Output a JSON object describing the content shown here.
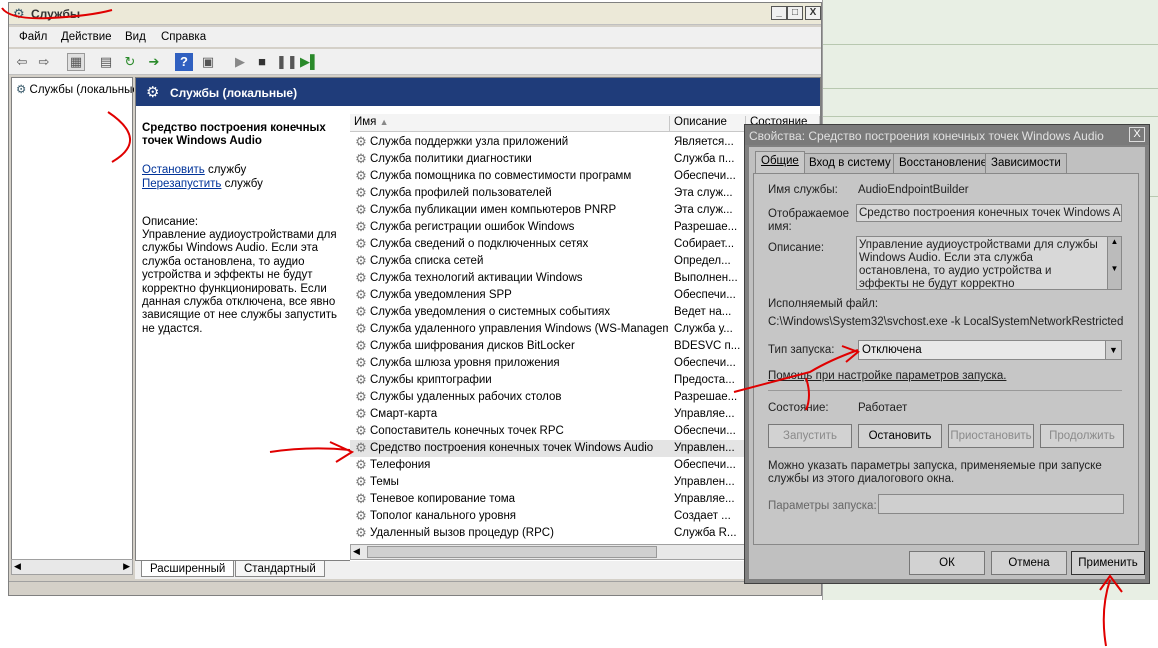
{
  "window": {
    "title": "Службы",
    "controls": [
      "_",
      "□",
      "X"
    ]
  },
  "menu": [
    "Файл",
    "Действие",
    "Вид",
    "Справка"
  ],
  "toolbar_icons": [
    "back-icon",
    "forward-icon",
    "console-tree-icon",
    "properties-icon",
    "refresh-icon",
    "export-icon",
    "help-icon",
    "view-icon",
    "play-icon",
    "stop-icon",
    "pause-icon",
    "restart-icon"
  ],
  "tree": {
    "item": "Службы (локальные)"
  },
  "content": {
    "header": "Службы (локальные)",
    "service_title": "Средство построения конечных точек Windows Audio",
    "stop_link": "Остановить",
    "stop_suffix": " службу",
    "restart_link": "Перезапустить",
    "restart_suffix": " службу",
    "desc_label": "Описание:",
    "desc_text": "Управление аудиоустройствами для службы Windows Audio.  Если эта служба остановлена, то аудио устройства и эффекты не будут корректно функционировать.  Если данная служба отключена, все явно зависящие от нее службы запустить не удастся."
  },
  "list": {
    "columns": [
      "Имя",
      "Описание",
      "Состояние"
    ],
    "rows": [
      {
        "name": "Служба поддержки узла приложений",
        "desc": "Является..."
      },
      {
        "name": "Служба политики диагностики",
        "desc": "Служба п..."
      },
      {
        "name": "Служба помощника по совместимости программ",
        "desc": "Обеспечи..."
      },
      {
        "name": "Служба профилей пользователей",
        "desc": "Эта служ..."
      },
      {
        "name": "Служба публикации имен компьютеров PNRP",
        "desc": "Эта служ..."
      },
      {
        "name": "Служба регистрации ошибок Windows",
        "desc": "Разрешае..."
      },
      {
        "name": "Служба сведений о подключенных сетях",
        "desc": "Собирает..."
      },
      {
        "name": "Служба списка сетей",
        "desc": "Определ..."
      },
      {
        "name": "Служба технологий активации Windows",
        "desc": "Выполнен..."
      },
      {
        "name": "Служба уведомления SPP",
        "desc": "Обеспечи..."
      },
      {
        "name": "Служба уведомления о системных событиях",
        "desc": "Ведет на..."
      },
      {
        "name": "Служба удаленного управления Windows (WS-Managem...",
        "desc": "Служба у..."
      },
      {
        "name": "Служба шифрования дисков BitLocker",
        "desc": "BDESVC п..."
      },
      {
        "name": "Служба шлюза уровня приложения",
        "desc": "Обеспечи..."
      },
      {
        "name": "Службы криптографии",
        "desc": "Предоста..."
      },
      {
        "name": "Службы удаленных рабочих столов",
        "desc": "Разрешае..."
      },
      {
        "name": "Смарт-карта",
        "desc": "Управляе..."
      },
      {
        "name": "Сопоставитель конечных точек RPC",
        "desc": "Обеспечи..."
      },
      {
        "name": "Средство построения конечных точек Windows Audio",
        "desc": "Управлен..."
      },
      {
        "name": "Телефония",
        "desc": "Обеспечи..."
      },
      {
        "name": "Темы",
        "desc": "Управлен..."
      },
      {
        "name": "Теневое копирование тома",
        "desc": "Управляе..."
      },
      {
        "name": "Тополог канального уровня",
        "desc": "Создает ..."
      },
      {
        "name": "Удаленный вызов процедур (RPC)",
        "desc": "Служба R..."
      }
    ],
    "selected_index": 18
  },
  "bottom_tabs": [
    "Расширенный",
    "Стандартный"
  ],
  "dialog": {
    "title": "Свойства: Средство построения конечных точек Windows Audio",
    "close": "X",
    "tabs": [
      "Общие",
      "Вход в систему",
      "Восстановление",
      "Зависимости"
    ],
    "service_name_label": "Имя службы:",
    "service_name": "AudioEndpointBuilder",
    "display_name_label": "Отображаемое имя:",
    "display_name": "Средство построения конечных точек Windows Audio",
    "description_label": "Описание:",
    "description": "Управление аудиоустройствами для службы Windows Audio.  Если эта служба остановлена, то аудио устройства и эффекты не будут корректно функционировать.  Если данная",
    "exe_label": "Исполняемый файл:",
    "exe_path": "C:\\Windows\\System32\\svchost.exe -k LocalSystemNetworkRestricted",
    "startup_type_label": "Тип запуска:",
    "startup_type": "Отключена",
    "help_link": "Помощь при настройке параметров запуска.",
    "state_label": "Состояние:",
    "state": "Работает",
    "btn_start": "Запустить",
    "btn_stop": "Остановить",
    "btn_pause": "Приостановить",
    "btn_continue": "Продолжить",
    "params_note": "Можно указать параметры запуска, применяемые при запуске службы из этого диалогового окна.",
    "params_label": "Параметры запуска:",
    "params_value": "",
    "btn_ok": "ОК",
    "btn_cancel": "Отмена",
    "btn_apply": "Применить"
  },
  "colors": {
    "header_bg": "#1f3c7a",
    "link": "#003399",
    "annotation": "#e00000"
  }
}
